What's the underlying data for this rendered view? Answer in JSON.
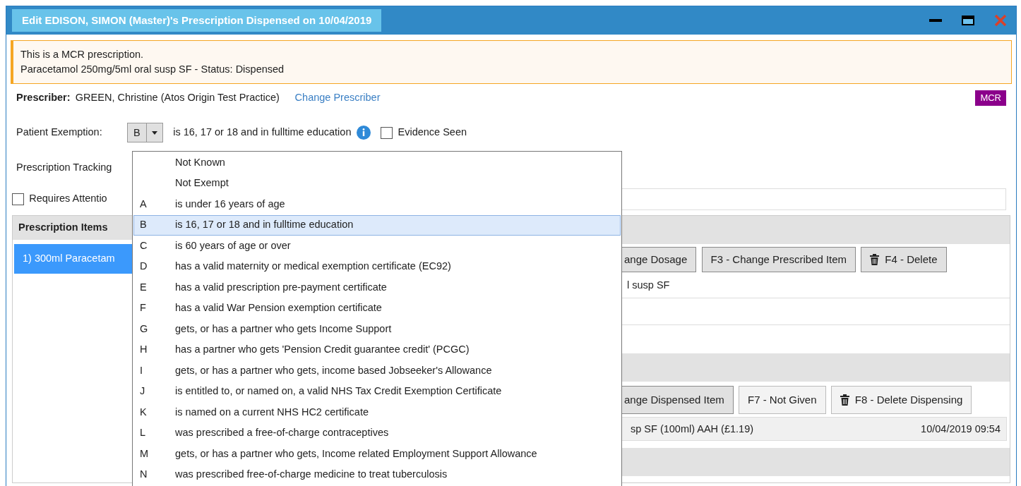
{
  "window": {
    "title": "Edit EDISON, SIMON (Master)'s Prescription Dispensed on 10/04/2019"
  },
  "alert": {
    "lines": [
      "This is a MCR prescription.",
      "Paracetamol 250mg/5ml oral susp SF - Status: Dispensed"
    ]
  },
  "prescriber": {
    "label": "Prescriber:",
    "value": "GREEN, Christine (Atos Origin Test Practice)",
    "link": "Change Prescriber",
    "badge": "MCR"
  },
  "exemption": {
    "label": "Patient Exemption:",
    "code": "B",
    "description": "is 16, 17 or 18 and in fulltime education",
    "evidence": {
      "label": "Evidence Seen",
      "checked": false
    }
  },
  "tracking": {
    "label": "Prescription Tracking"
  },
  "requires_attention": {
    "label": "Requires Attentio",
    "checked": false
  },
  "prescription_items": {
    "title": "Prescription Items",
    "items": [
      {
        "label": "1) 300ml Paracetam",
        "selected": true
      }
    ]
  },
  "prescribed_item": {
    "buttons": [
      {
        "label": "ange Dosage",
        "kind": "plain",
        "flat": false
      },
      {
        "label": "F3 - Change Prescribed Item",
        "kind": "plain",
        "flat": false
      },
      {
        "label": "F4 - Delete",
        "kind": "delete",
        "flat": false
      }
    ],
    "description": "l susp SF"
  },
  "dispensing": {
    "buttons": [
      {
        "label": "ange Dispensed Item",
        "kind": "plain",
        "flat": false
      },
      {
        "label": "F7 - Not Given",
        "kind": "plain",
        "flat": true
      },
      {
        "label": "F8 - Delete Dispensing",
        "kind": "delete",
        "flat": true
      }
    ],
    "row": {
      "description": "sp SF (100ml) AAH (£1.19)",
      "date": "10/04/2019 09:54"
    }
  },
  "dropdown": {
    "options": [
      {
        "label": "Not Known",
        "selected": false
      },
      {
        "label": "Not Exempt",
        "selected": false
      },
      {
        "code": "A",
        "label": "is under 16 years of age",
        "selected": false
      },
      {
        "code": "B",
        "label": "is 16, 17 or 18 and in fulltime education",
        "selected": true
      },
      {
        "code": "C",
        "label": "is 60 years of age or over",
        "selected": false
      },
      {
        "code": "D",
        "label": "has a valid maternity or medical exemption certificate (EC92)",
        "selected": false
      },
      {
        "code": "E",
        "label": "has a valid prescription pre-payment certificate",
        "selected": false
      },
      {
        "code": "F",
        "label": "has a valid War Pension exemption certificate",
        "selected": false
      },
      {
        "code": "G",
        "label": "gets, or has a partner who gets Income Support",
        "selected": false
      },
      {
        "code": "H",
        "label": "has a partner who gets 'Pension Credit guarantee credit' (PCGC)",
        "selected": false
      },
      {
        "code": "I",
        "label": "gets, or has a partner who gets, income based Jobseeker's Allowance",
        "selected": false
      },
      {
        "code": "J",
        "label": "is entitled to, or named on, a valid NHS Tax Credit Exemption Certificate",
        "selected": false
      },
      {
        "code": "K",
        "label": "is named on a current NHS HC2 certificate",
        "selected": false
      },
      {
        "code": "L",
        "label": "was prescribed a free-of-charge contraceptives",
        "selected": false
      },
      {
        "code": "M",
        "label": "gets, or has a partner who gets, Income related Employment Support Allowance",
        "selected": false
      },
      {
        "code": "N",
        "label": "was prescribed free-of-charge medicine to treat tuberculosis",
        "selected": false
      }
    ]
  }
}
